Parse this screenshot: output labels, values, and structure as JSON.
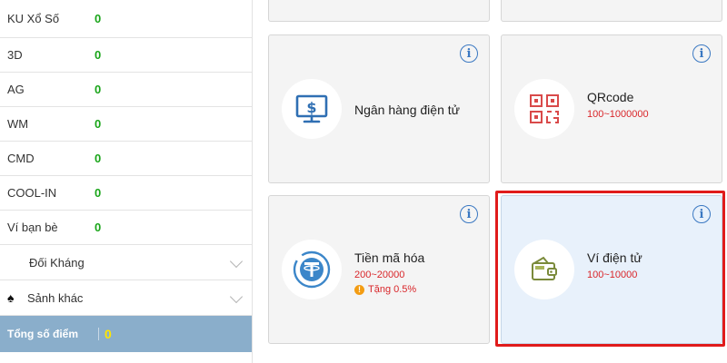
{
  "sidebar": {
    "rows": [
      {
        "name": "KU Xổ Số",
        "value": "0"
      },
      {
        "name": "3D",
        "value": "0"
      },
      {
        "name": "AG",
        "value": "0"
      },
      {
        "name": "WM",
        "value": "0"
      },
      {
        "name": "CMD",
        "value": "0"
      },
      {
        "name": "COOL-IN",
        "value": "0"
      },
      {
        "name": "Ví bạn bè",
        "value": "0"
      }
    ],
    "groups": {
      "doi_khang": "Đối Kháng",
      "sanh_khac": "Sảnh khác"
    },
    "total": {
      "label": "Tổng số điểm",
      "value": "0"
    }
  },
  "cards": {
    "ebank": {
      "title": "Ngân hàng điện tử"
    },
    "qrcode": {
      "title": "QRcode",
      "range": "100~1000000"
    },
    "crypto": {
      "title": "Tiền mã hóa",
      "range": "200~20000",
      "bonus": "Tặng 0.5%"
    },
    "ewallet": {
      "title": "Ví điện tử",
      "range": "100~10000"
    }
  },
  "colors": {
    "accent_blue": "#3a78c2",
    "value_green": "#1aa51a",
    "range_red": "#d9262a",
    "highlight_red": "#e01b1b",
    "total_bg": "#8aaecb",
    "total_value": "#ffe600"
  },
  "icons": {
    "info": "info-icon",
    "ebank": "monitor-dollar-icon",
    "qrcode": "qrcode-icon",
    "crypto": "tether-icon",
    "ewallet": "wallet-icon"
  }
}
